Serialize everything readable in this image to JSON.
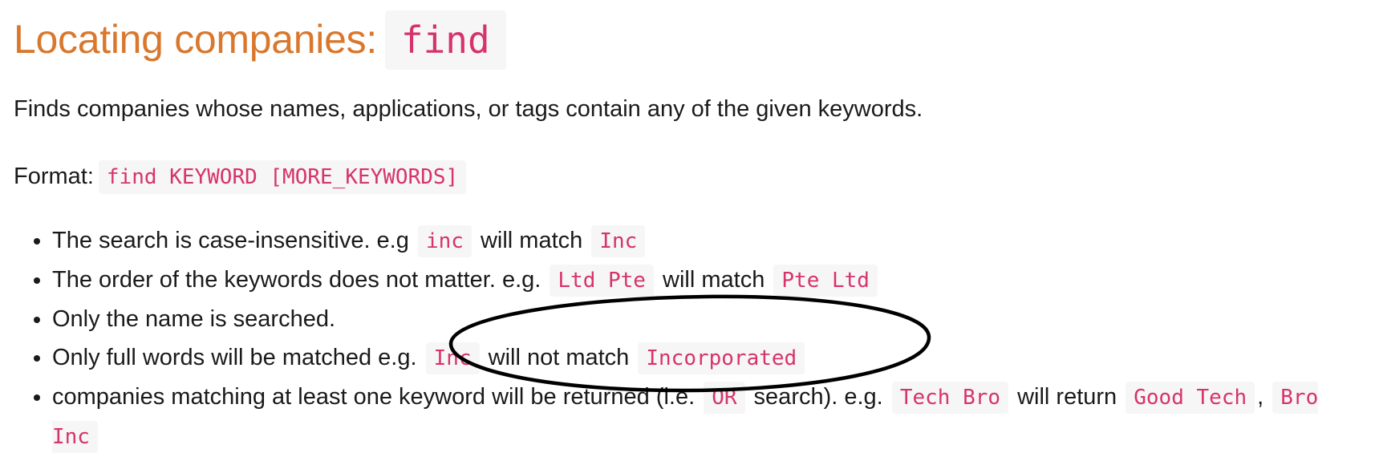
{
  "heading": {
    "text": "Locating companies:",
    "command": "find"
  },
  "description": "Finds companies whose names, applications, or tags contain any of the given keywords.",
  "format": {
    "label": "Format:",
    "syntax": "find KEYWORD [MORE_KEYWORDS]"
  },
  "rules": [
    {
      "before": "The search is case-insensitive. e.g ",
      "code1": "inc",
      "middle": " will match ",
      "code2": "Inc"
    },
    {
      "before": "The order of the keywords does not matter. e.g. ",
      "code1": "Ltd Pte",
      "middle": " will match ",
      "code2": "Pte Ltd"
    },
    {
      "text": "Only the name is searched."
    },
    {
      "before": "Only full words will be matched e.g. ",
      "code1": "Inc",
      "middle": " will not match ",
      "code2": "Incorporated"
    },
    {
      "before": "companies matching at least one keyword will be returned (i.e. ",
      "code1": "OR",
      "middle": " search). e.g. ",
      "code2": "Tech Bro",
      "middle2": " will return ",
      "code3": "Good Tech",
      "sep": ", ",
      "code4": "Bro Inc"
    }
  ],
  "colors": {
    "heading": "#d9782d",
    "code_text": "#d6336c",
    "code_bg": "#f6f6f6",
    "annotation_stroke": "#000000"
  }
}
